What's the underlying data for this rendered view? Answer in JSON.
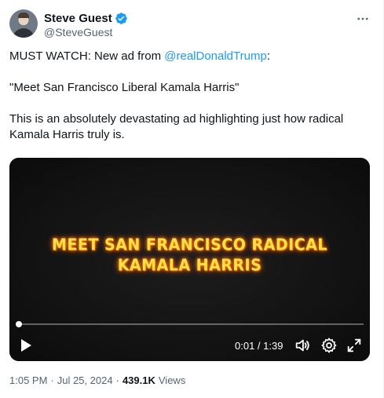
{
  "author": {
    "display_name": "Steve Guest",
    "handle": "@SteveGuest",
    "verified": true
  },
  "tweet": {
    "line1_prefix": "MUST WATCH: New ad from ",
    "line1_mention": "@realDonaldTrump",
    "line1_suffix": ":",
    "line2": "\"Meet San Francisco Liberal Kamala Harris\"",
    "line3": "This is an absolutely devastating ad highlighting just how radical Kamala Harris truly is."
  },
  "video": {
    "title_line1": "MEET SAN FRANCISCO RADICAL",
    "title_line2": "KAMALA HARRIS",
    "time_display": "0:01 / 1:39",
    "progress_fraction": 0.01
  },
  "meta": {
    "time": "1:05 PM",
    "separator": "·",
    "date": "Jul 25, 2024",
    "views_count": "439.1K",
    "views_label": "Views"
  },
  "colors": {
    "accent": "#1d9bf0",
    "text": "#0f1419",
    "muted": "#536471",
    "video_title": "#ffe04a"
  },
  "icons": {
    "verified": "verified-badge-icon",
    "more": "more-icon",
    "play": "play-icon",
    "volume": "volume-icon",
    "settings": "settings-gear-icon",
    "fullscreen": "fullscreen-icon"
  }
}
